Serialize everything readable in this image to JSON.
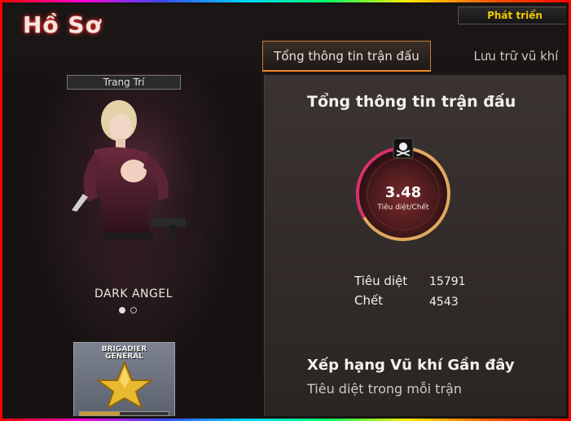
{
  "header": {
    "title": "Hồ Sơ",
    "dev_button": "Phát triển"
  },
  "tabs": [
    {
      "label": "Tổng thông tin trận đấu",
      "active": true
    },
    {
      "label": "Lưu trữ vũ khí",
      "active": false
    }
  ],
  "character": {
    "decoration_label": "Trang Trí",
    "name": "DARK ANGEL",
    "carousel_pages": 2,
    "carousel_active": 1
  },
  "rank": {
    "label_line1": "BRIGADIER",
    "label_line2": "GENERAL",
    "icon": "gold-star-icon",
    "progress": 0.45
  },
  "stats": {
    "section_title": "Tổng thông tin trận đấu",
    "kd_ratio": "3.48",
    "kd_label": "Tiêu diệt/Chết",
    "kills_label": "Tiêu diệt",
    "kills_value": "15791",
    "deaths_label": "Chết",
    "deaths_value": "4543",
    "kd_icon": "skull-crossbones-icon"
  },
  "weapons": {
    "section_title": "Xếp hạng Vũ khí Gần đây",
    "subtitle": "Tiêu diệt trong mỗi trận"
  },
  "colors": {
    "accent": "#f08a2a",
    "dev_button_text": "#f0c800",
    "title_glow": "#ff2a2a"
  }
}
